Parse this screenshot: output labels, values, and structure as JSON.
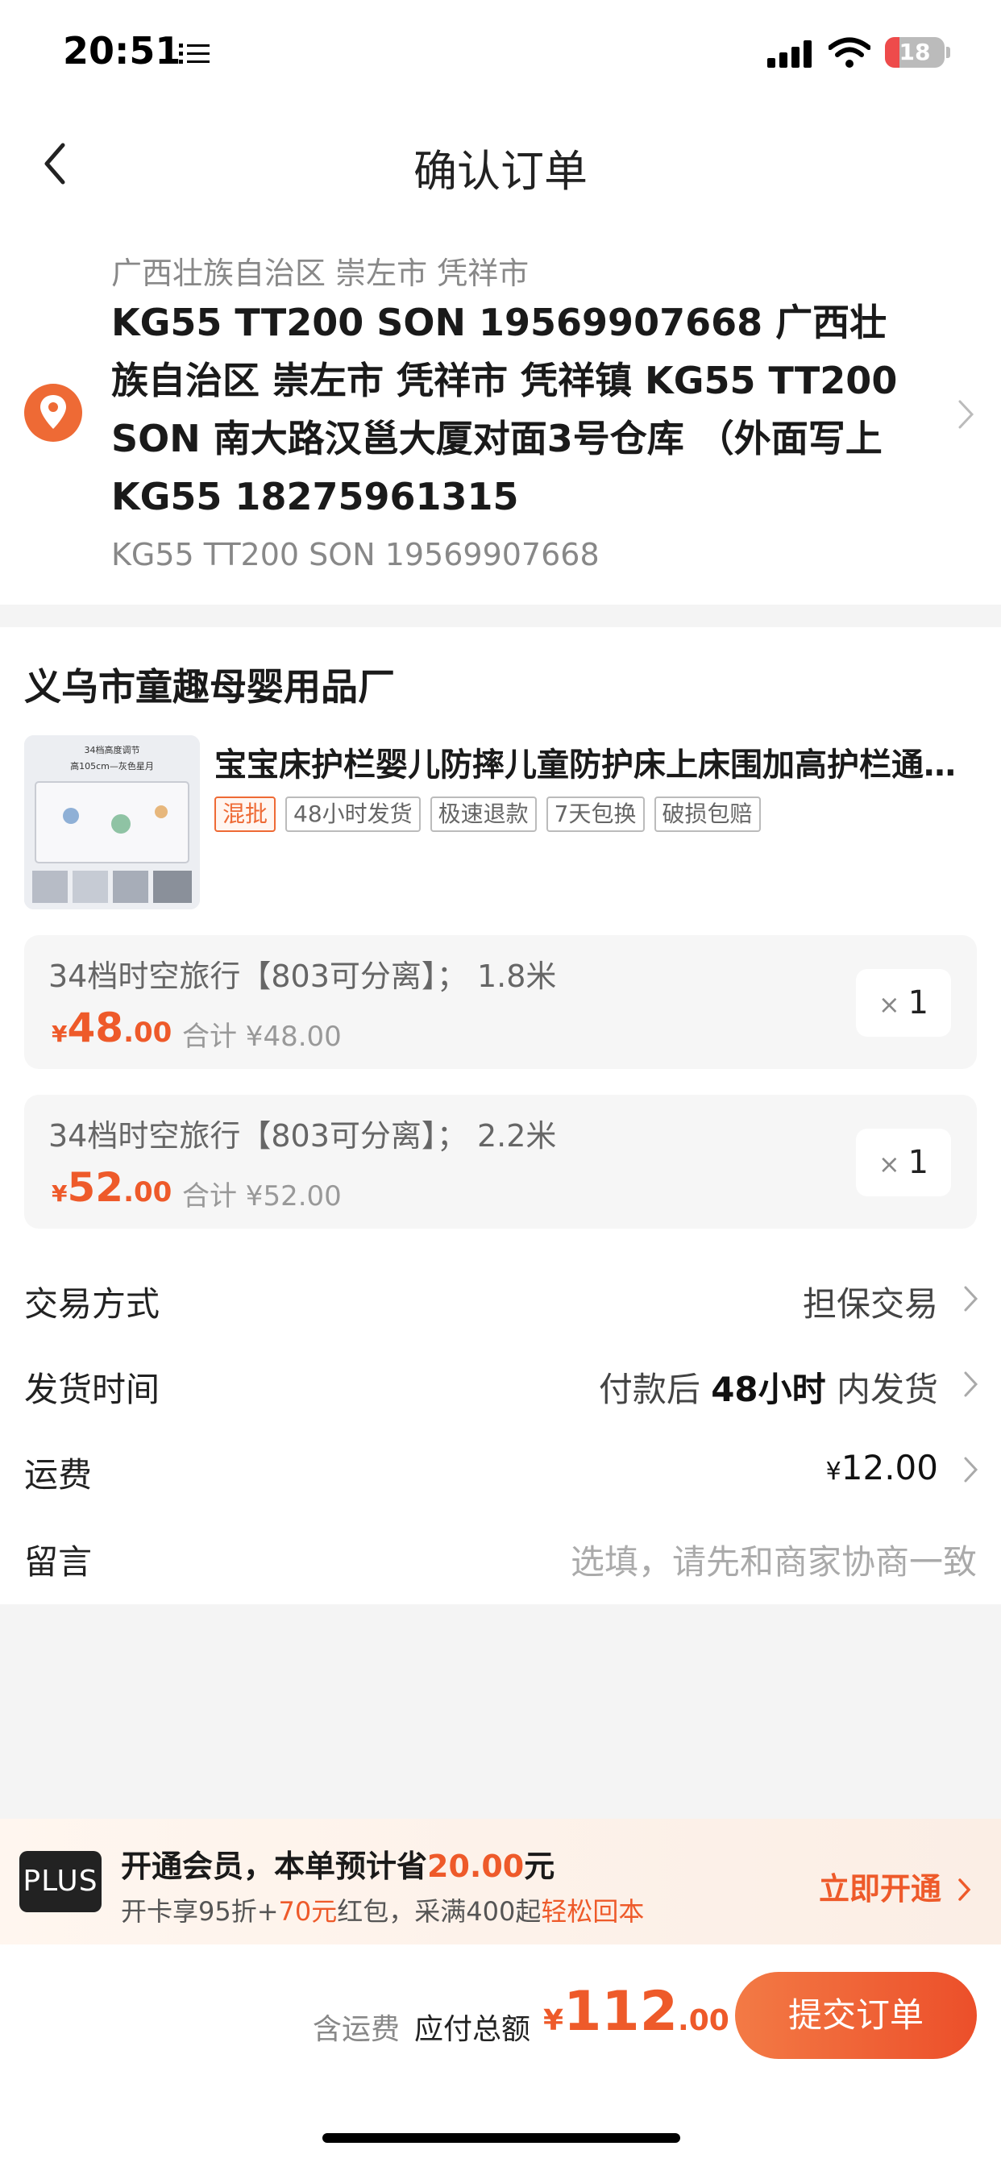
{
  "status_bar": {
    "time": "20:51",
    "battery": "18"
  },
  "nav": {
    "title": "确认订单"
  },
  "address": {
    "region": "广西壮族自治区 崇左市 凭祥市",
    "detail": "KG55 TT200 SON 19569907668 广西壮族自治区 崇左市 凭祥市 凭祥镇 KG55 TT200 SON 南大路汉邕大厦对面3号仓库 （外面写上KG55 18275961315",
    "contact": "KG55 TT200 SON   19569907668"
  },
  "shop": {
    "name": "义乌市童趣母婴用品厂",
    "product": {
      "title": "宝宝床护栏婴儿防摔儿童防护床上床围加高护栏通用...",
      "thumb_text_1": "34档高度调节",
      "thumb_text_2": "高105cm—灰色星月",
      "tags": [
        "混批",
        "48小时发货",
        "极速退款",
        "7天包换",
        "破损包赔"
      ]
    },
    "skus": [
      {
        "name": "34档时空旅行【803可分离】； 1.8米",
        "yen": "¥",
        "price_int": "48",
        "price_dec": ".00",
        "total": "合计 ¥48.00",
        "qty_x": "×",
        "qty": "1"
      },
      {
        "name": "34档时空旅行【803可分离】； 2.2米",
        "yen": "¥",
        "price_int": "52",
        "price_dec": ".00",
        "total": "合计 ¥52.00",
        "qty_x": "×",
        "qty": "1"
      }
    ]
  },
  "rows": {
    "trade": {
      "label": "交易方式",
      "value": "担保交易"
    },
    "ship_time": {
      "label": "发货时间",
      "value_pre": "付款后 ",
      "value_bold": "48小时",
      "value_post": " 内发货"
    },
    "freight": {
      "label": "运费",
      "yen": "¥",
      "value": "12.00"
    },
    "message": {
      "label": "留言",
      "placeholder": "选填，请先和商家协商一致"
    }
  },
  "plus": {
    "badge": "PLUS",
    "line1_pre": "开通会员，本单预计省",
    "line1_amount": "20.00",
    "line1_post": "元",
    "line2_a": "开卡享95折+",
    "line2_b": "70元",
    "line2_c": "红包，采满400起",
    "line2_d": "轻松回本",
    "cta": "立即开通"
  },
  "bottom": {
    "ship_note": "含运费",
    "total_label": "应付总额",
    "yen": "¥",
    "total_int": "112",
    "total_dec": ".00",
    "submit": "提交订单"
  },
  "colors": {
    "accent": "#ee5a2a",
    "pin": "#ee6a35"
  }
}
